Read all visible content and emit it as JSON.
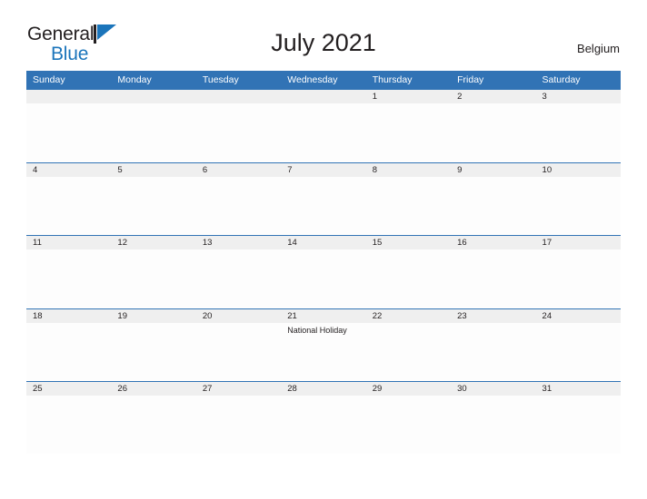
{
  "brand": {
    "word_one": "General",
    "word_two": "Blue",
    "flag_icon": "blue-flag-logo-icon",
    "color_primary": "#1b75bb",
    "color_text": "#231f20"
  },
  "header": {
    "title": "July 2021",
    "country": "Belgium"
  },
  "calendar": {
    "accent_color": "#3173b5",
    "band_color": "#efefef",
    "weekdays": [
      "Sunday",
      "Monday",
      "Tuesday",
      "Wednesday",
      "Thursday",
      "Friday",
      "Saturday"
    ],
    "weeks": [
      [
        {
          "day": "",
          "event": ""
        },
        {
          "day": "",
          "event": ""
        },
        {
          "day": "",
          "event": ""
        },
        {
          "day": "",
          "event": ""
        },
        {
          "day": "1",
          "event": ""
        },
        {
          "day": "2",
          "event": ""
        },
        {
          "day": "3",
          "event": ""
        }
      ],
      [
        {
          "day": "4",
          "event": ""
        },
        {
          "day": "5",
          "event": ""
        },
        {
          "day": "6",
          "event": ""
        },
        {
          "day": "7",
          "event": ""
        },
        {
          "day": "8",
          "event": ""
        },
        {
          "day": "9",
          "event": ""
        },
        {
          "day": "10",
          "event": ""
        }
      ],
      [
        {
          "day": "11",
          "event": ""
        },
        {
          "day": "12",
          "event": ""
        },
        {
          "day": "13",
          "event": ""
        },
        {
          "day": "14",
          "event": ""
        },
        {
          "day": "15",
          "event": ""
        },
        {
          "day": "16",
          "event": ""
        },
        {
          "day": "17",
          "event": ""
        }
      ],
      [
        {
          "day": "18",
          "event": ""
        },
        {
          "day": "19",
          "event": ""
        },
        {
          "day": "20",
          "event": ""
        },
        {
          "day": "21",
          "event": "National Holiday"
        },
        {
          "day": "22",
          "event": ""
        },
        {
          "day": "23",
          "event": ""
        },
        {
          "day": "24",
          "event": ""
        }
      ],
      [
        {
          "day": "25",
          "event": ""
        },
        {
          "day": "26",
          "event": ""
        },
        {
          "day": "27",
          "event": ""
        },
        {
          "day": "28",
          "event": ""
        },
        {
          "day": "29",
          "event": ""
        },
        {
          "day": "30",
          "event": ""
        },
        {
          "day": "31",
          "event": ""
        }
      ]
    ]
  }
}
